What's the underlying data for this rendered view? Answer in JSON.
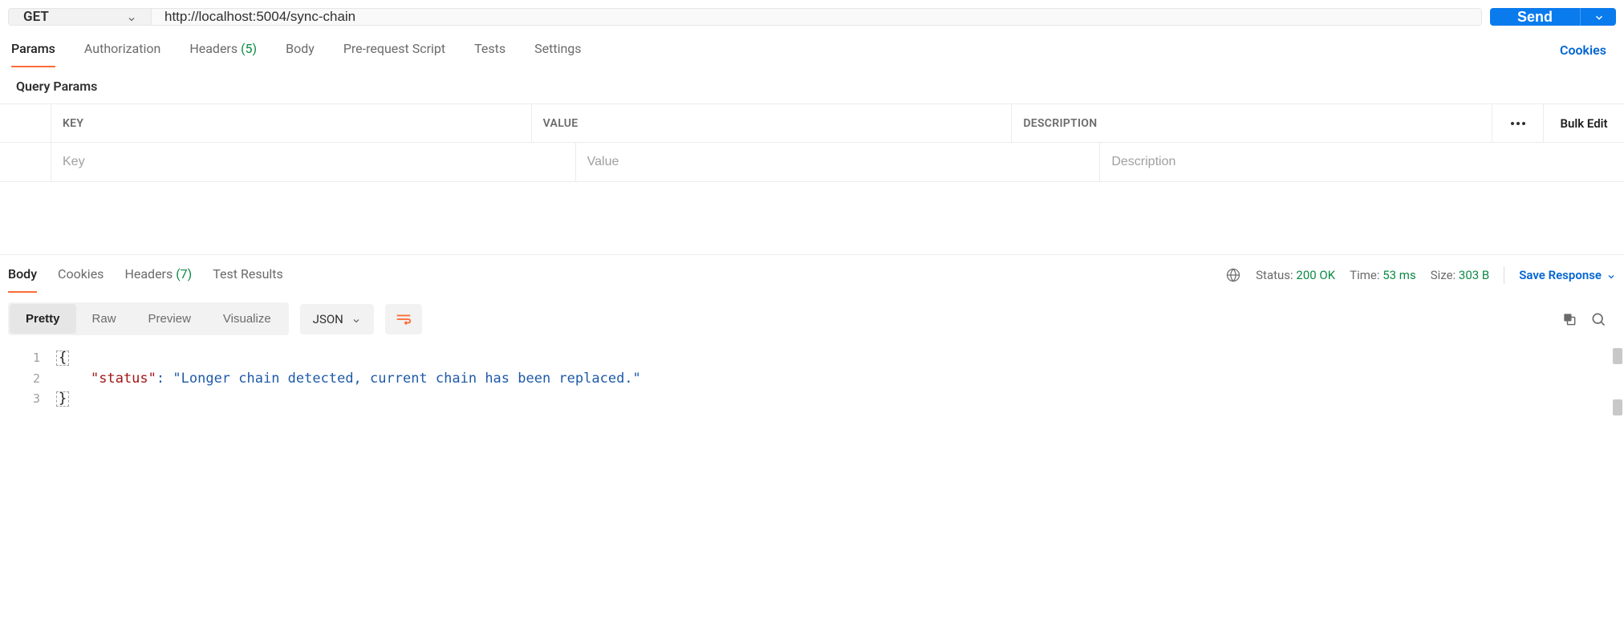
{
  "request": {
    "method": "GET",
    "url": "http://localhost:5004/sync-chain",
    "send_label": "Send"
  },
  "request_tabs": {
    "params": "Params",
    "authorization": "Authorization",
    "headers_label": "Headers",
    "headers_count": "(5)",
    "body": "Body",
    "pre_request": "Pre-request Script",
    "tests": "Tests",
    "settings": "Settings",
    "cookies_link": "Cookies"
  },
  "params_section": {
    "title": "Query Params",
    "columns": {
      "key": "KEY",
      "value": "VALUE",
      "description": "DESCRIPTION"
    },
    "placeholders": {
      "key": "Key",
      "value": "Value",
      "description": "Description"
    },
    "bulk_edit": "Bulk Edit"
  },
  "response_tabs": {
    "body": "Body",
    "cookies": "Cookies",
    "headers_label": "Headers",
    "headers_count": "(7)",
    "test_results": "Test Results"
  },
  "response_meta": {
    "status_label": "Status:",
    "status_value": "200 OK",
    "time_label": "Time:",
    "time_value": "53 ms",
    "size_label": "Size:",
    "size_value": "303 B",
    "save_response": "Save Response"
  },
  "viewer": {
    "modes": {
      "pretty": "Pretty",
      "raw": "Raw",
      "preview": "Preview",
      "visualize": "Visualize"
    },
    "lang": "JSON"
  },
  "response_body": {
    "line_numbers": [
      "1",
      "2",
      "3"
    ],
    "open_brace": "{",
    "close_brace": "}",
    "kv_key_quoted": "\"status\"",
    "kv_colon": ":",
    "kv_value_quoted": "\"Longer chain detected, current chain has been replaced.\""
  }
}
